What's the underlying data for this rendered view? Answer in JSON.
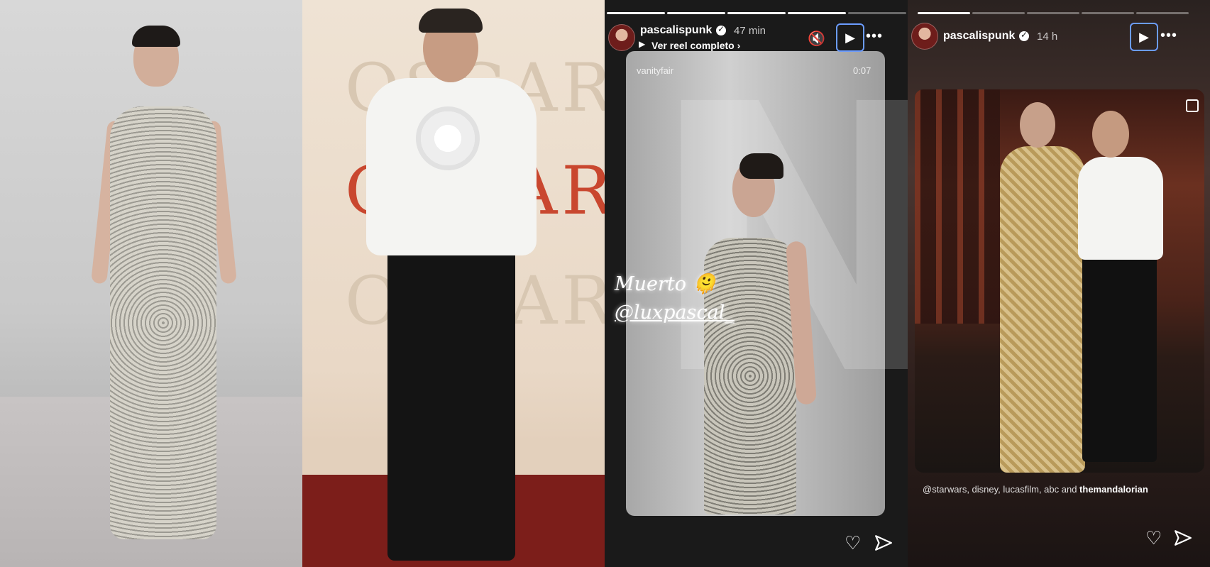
{
  "panel3": {
    "progress": {
      "segments": 5,
      "completed": 4
    },
    "username": "pascalispunk",
    "time": "47 min",
    "reel_link": "Ver reel completo",
    "source": "vanityfair",
    "video_time": "0:07",
    "sticker_line1": "Muerto",
    "sticker_line2": "@luxpascal_",
    "icons": [
      "mute-icon",
      "play-icon",
      "more-icon",
      "heart-icon",
      "send-icon"
    ]
  },
  "panel2": {
    "watermark": "OSCARS"
  },
  "panel4": {
    "progress": {
      "segments": 5,
      "completed": 1
    },
    "username": "pascalispunk",
    "time": "14 h",
    "caption_prefix": "@starwars, disney, lucasfilm, abc and ",
    "caption_last": "themandalorian",
    "icons": [
      "play-icon",
      "more-icon",
      "heart-icon",
      "send-icon",
      "multi-image-icon"
    ]
  },
  "colors": {
    "focus_outline": "#6b9cff",
    "text": "#ffffff"
  }
}
